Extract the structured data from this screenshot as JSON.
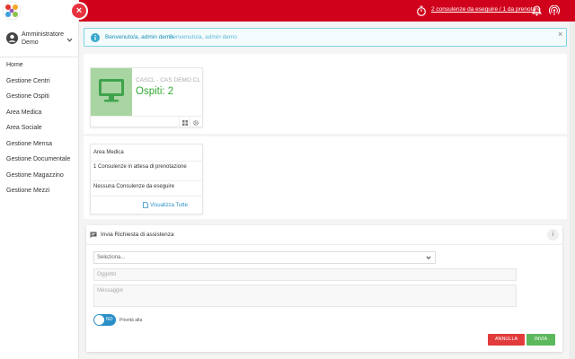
{
  "header": {
    "close_glyph": "×",
    "consult_link": "2 consulenze da eseguire / 1 da prenotare",
    "colors": {
      "primary": "#d0021b",
      "accent": "#2a8fc7",
      "success": "#5cb85c",
      "danger": "#e23b3b"
    }
  },
  "user": {
    "name": "Amministratore Demo"
  },
  "nav": {
    "items": [
      "Home",
      "Gestione Centri",
      "Gestione Ospiti",
      "Area Medica",
      "Area Sociale",
      "Gestione Mensa",
      "Gestione Documentale",
      "Gestione Magazzino",
      "Gestione Mezzi"
    ]
  },
  "alert": {
    "strong": "Benvenuto/a, admin demo",
    "light": "Benvenuto/a, admin demo",
    "close": "×"
  },
  "center_card": {
    "name": "CASCL - CAS DEMO CL",
    "guests": "Ospiti: 2",
    "icons": [
      "grid-icon",
      "gear-icon"
    ]
  },
  "medical_card": {
    "title": "Area Medica",
    "line1": "1 Consulenze in attesa di prenotazione",
    "line2": "Nessuna Consulenze da eseguire",
    "link": "Visualizza Tutte"
  },
  "request": {
    "title": "Invia Richiesta di assistenza",
    "info": "i",
    "select_value": "Seleziona...",
    "subject_placeholder": "Oggetto",
    "message_placeholder": "Messaggio",
    "toggle_label": "NO",
    "priority_label": "Priorità alta",
    "cancel": "ANNULLA",
    "send": "INVIA"
  }
}
